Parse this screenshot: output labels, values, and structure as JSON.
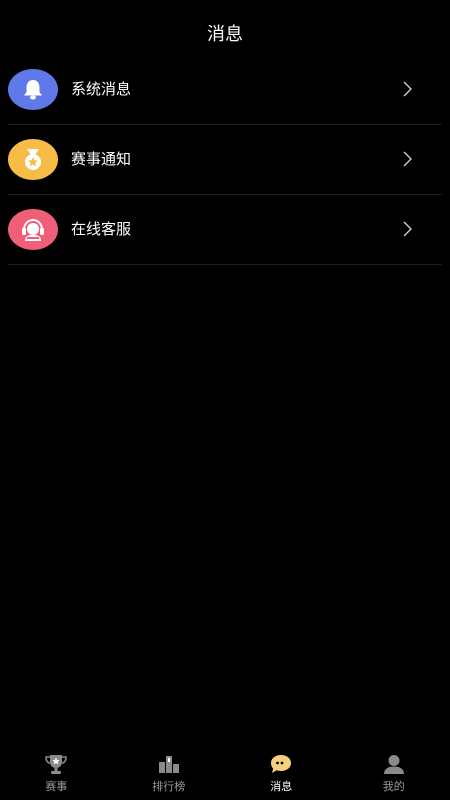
{
  "header": {
    "title": "消息"
  },
  "messages": [
    {
      "label": "系统消息",
      "icon": "bell-icon",
      "color": "#5f7ae8"
    },
    {
      "label": "赛事通知",
      "icon": "medal-icon",
      "color": "#f6bc45"
    },
    {
      "label": "在线客服",
      "icon": "headset-agent-icon",
      "color": "#ef5f78"
    }
  ],
  "tabbar": {
    "items": [
      {
        "label": "赛事",
        "icon": "trophy-icon",
        "active": false
      },
      {
        "label": "排行榜",
        "icon": "podium-icon",
        "active": false
      },
      {
        "label": "消息",
        "icon": "chat-bubble-icon",
        "active": true
      },
      {
        "label": "我的",
        "icon": "user-icon",
        "active": false
      }
    ],
    "active_color": "#f6d17d",
    "inactive_color": "#9a9a9a"
  }
}
